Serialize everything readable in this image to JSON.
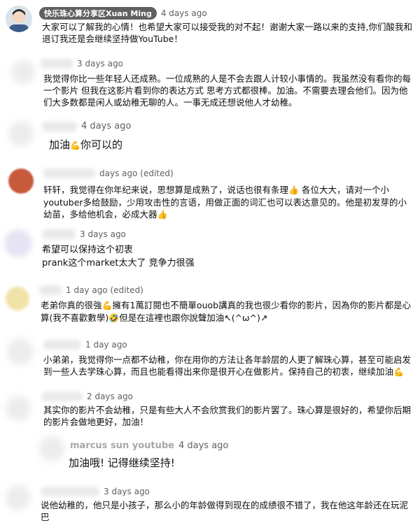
{
  "comments": [
    {
      "author": "快乐珠心算分享区Xuan Ming",
      "time": "4 days ago",
      "text": "大家可以了解我的心情！也希望大家可以接受我的对不起！谢谢大家一路以来的支持,你们酸我和退订我还是会继续坚持做YouTube！"
    },
    {
      "time": "3 days ago",
      "text": "我觉得你比一些年轻人还成熟。一位成熟的人是不会去跟人计较小事情的。我虽然没有看你的每一个影片 但我在这影片看到你的表达方式 思考方式都很棒。加油。不需要去理会他们。因为他们大多数都是闲人或幼稚无聊的人。一事无成还想说他人才幼稚。"
    },
    {
      "time": "4 days ago",
      "text_a": "加油",
      "text_b": "你可以的"
    },
    {
      "time": "days ago (edited)",
      "text_a": "轩轩，我觉得在你年纪来说，思想算是成熟了，说话也很有条理",
      "text_b": "各位大大，请对一个小youtuber多给鼓励，少用攻击性的言语，用做正面的词汇也可以表达意见的。他是初发芽的小幼苗，多给他机会，必成大器"
    },
    {
      "time": "3 days ago",
      "line1": "希望可以保持这个初衷",
      "line2": "prank这个market太大了 竞争力很强"
    },
    {
      "time": "1 day ago (edited)",
      "text_a": "老弟你真的很強",
      "text_b": "擁有1萬訂閱也不簡單ouob講真的我也很少看你的影片，因為你的影片都是心算(我不喜歡數學)",
      "text_c": "但是在這裡也跟你說聲加油↖(^ω^)↗"
    },
    {
      "time": "1 day ago",
      "text": "小弟弟，我觉得你一点都不幼稚，你在用你的方法让各年龄层的人更了解珠心算，甚至可能启发到一些人去学珠心算，而且也能看得出来你是很开心在做影片。保持自己的初衷，继续加油"
    },
    {
      "time": "2 days ago",
      "text": "其实你的影片不会幼稚，只是有些大人不会欣赏我们的影片罢了。珠心算是很好的，希望你后期的影片会做地更好，加油！"
    },
    {
      "author": "marcus sun youtube",
      "time": "4 days ago",
      "text": "加油哦! 记得继续坚持!"
    },
    {
      "time": "3 days ago",
      "text": "说他幼稚的，他只是小孩子，那么小的年龄做得到现在的成绩很不错了，我在他这年龄还在玩泥巴"
    }
  ],
  "icons": {
    "flex": "flexed-biceps-emoji",
    "thumb": "thumbs-up-emoji",
    "grin": "grinning-face-emoji"
  }
}
